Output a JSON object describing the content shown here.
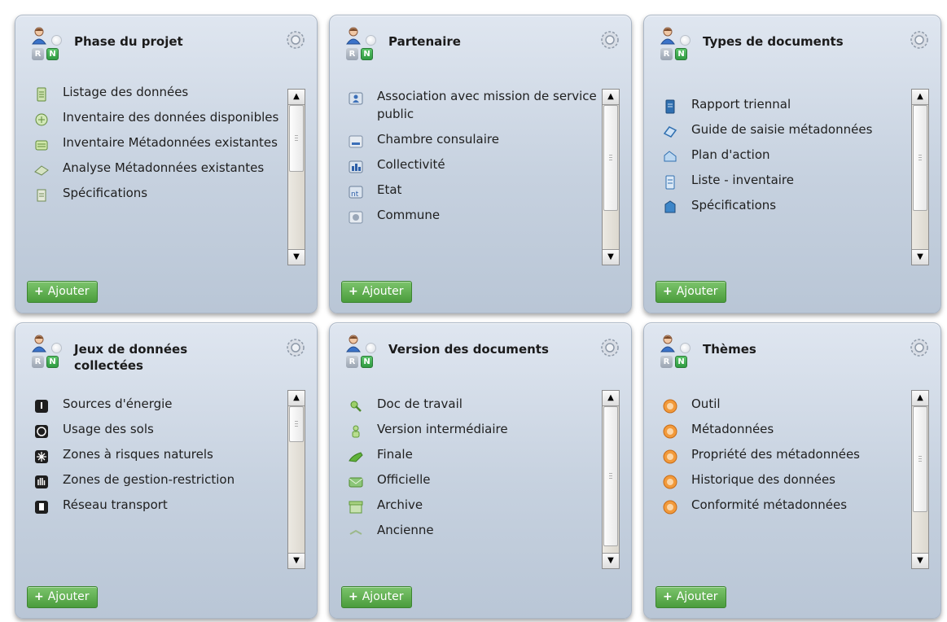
{
  "common": {
    "add_label": "Ajouter",
    "add_plus": "+",
    "badge_r": "R",
    "badge_n": "N",
    "scroll_up": "▲",
    "scroll_down": "▼"
  },
  "panels": [
    {
      "title": "Phase du projet",
      "items": [
        {
          "label": "Listage des données",
          "icon": "document-list-icon"
        },
        {
          "label": "Inventaire des données disponibles",
          "icon": "inventory-icon"
        },
        {
          "label": "Inventaire Métadonnées existantes",
          "icon": "metadata-inventory-icon"
        },
        {
          "label": "Analyse Métadonnées existantes",
          "icon": "analysis-icon"
        },
        {
          "label": "Spécifications",
          "icon": "specifications-icon"
        }
      ]
    },
    {
      "title": "Partenaire",
      "items": [
        {
          "label": "Association avec mission de service public",
          "icon": "association-icon"
        },
        {
          "label": "Chambre consulaire",
          "icon": "chamber-icon"
        },
        {
          "label": "Collectivité",
          "icon": "community-icon"
        },
        {
          "label": "Etat",
          "icon": "state-icon"
        },
        {
          "label": "Commune",
          "icon": "municipality-icon"
        }
      ]
    },
    {
      "title": "Types de documents",
      "items": [
        {
          "label": "Rapport triennal",
          "icon": "report-icon"
        },
        {
          "label": "Guide de saisie métadonnées",
          "icon": "guide-icon"
        },
        {
          "label": "Plan d'action",
          "icon": "action-plan-icon"
        },
        {
          "label": "Liste - inventaire",
          "icon": "list-inventory-icon"
        },
        {
          "label": "Spécifications",
          "icon": "specifications-icon"
        }
      ]
    },
    {
      "title": "Jeux de données collectées",
      "items": [
        {
          "label": "Sources d'énergie",
          "icon": "energy-icon"
        },
        {
          "label": "Usage des sols",
          "icon": "land-use-icon"
        },
        {
          "label": "Zones à risques naturels",
          "icon": "natural-risk-icon"
        },
        {
          "label": "Zones  de gestion-restriction",
          "icon": "management-zone-icon"
        },
        {
          "label": "Réseau transport",
          "icon": "transport-icon"
        }
      ]
    },
    {
      "title": "Version des documents",
      "items": [
        {
          "label": "Doc de travail",
          "icon": "work-doc-icon"
        },
        {
          "label": "Version intermédiaire",
          "icon": "intermediate-version-icon"
        },
        {
          "label": "Finale",
          "icon": "final-icon"
        },
        {
          "label": "Officielle",
          "icon": "official-icon"
        },
        {
          "label": "Archive",
          "icon": "archive-icon"
        },
        {
          "label": "Ancienne",
          "icon": "old-icon"
        }
      ]
    },
    {
      "title": "Thèmes",
      "items": [
        {
          "label": "Outil",
          "icon": "theme-bullet-icon"
        },
        {
          "label": "Métadonnées",
          "icon": "theme-bullet-icon"
        },
        {
          "label": "Propriété des métadonnées",
          "icon": "theme-bullet-icon"
        },
        {
          "label": "Historique des données",
          "icon": "theme-bullet-icon"
        },
        {
          "label": "Conformité métadonnées",
          "icon": "theme-bullet-icon"
        }
      ]
    }
  ]
}
